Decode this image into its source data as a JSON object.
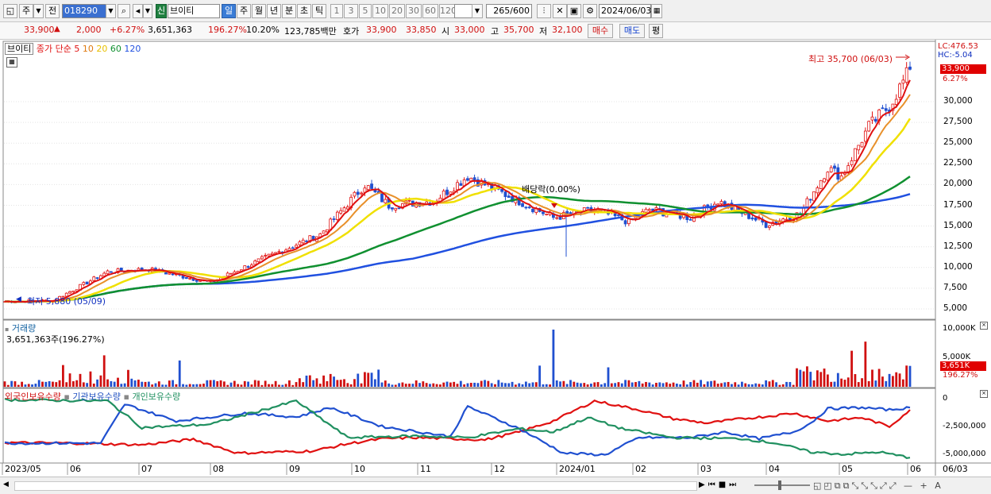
{
  "toolbar": {
    "market_btn": "주",
    "prev_btn": "전",
    "code": "018290",
    "badge": "신",
    "name": "브이티",
    "period_tabs": [
      "일",
      "주",
      "월",
      "년",
      "분",
      "초",
      "틱"
    ],
    "interval_tabs": [
      "1",
      "3",
      "5",
      "10",
      "20",
      "30",
      "60",
      "120"
    ],
    "count": "265",
    "count_total": "/600",
    "date": "2024/06/03"
  },
  "info": {
    "price": "33,900",
    "arrow": "▲",
    "change": "2,000",
    "rate": "+6.27%",
    "volume": "3,651,363",
    "vol_ratio": "196.27%",
    "turnover": "10.20%",
    "amount": "123,785백만",
    "ask_label": "호가",
    "ask": "33,900",
    "bid": "33,850",
    "open_label": "시",
    "open": "33,000",
    "high_label": "고",
    "high": "35,700",
    "low_label": "저",
    "low": "32,100",
    "buy_btn": "매수",
    "sell_btn": "매도",
    "eval_btn": "평"
  },
  "price_panel": {
    "name_tag": "브이티",
    "legend_label": "종가 단순",
    "ma_labels": [
      "5",
      "10",
      "20",
      "60",
      "120"
    ],
    "ma_colors": [
      "#e01010",
      "#e07a10",
      "#e8d000",
      "#109030",
      "#2050e0"
    ],
    "lc": "LC:476.53",
    "hc": "HC:-5.04",
    "cur_price": "33,900",
    "cur_rate": "6.27%",
    "high_note": "최고 35,700 (06/03)",
    "low_note": "최저 5,880 (05/09)",
    "div_note": "배당락(0.00%)",
    "y_ticks": [
      "30,000",
      "27,500",
      "25,000",
      "22,500",
      "20,000",
      "17,500",
      "15,000",
      "12,500",
      "10,000",
      "7,500",
      "5,000"
    ]
  },
  "volume_panel": {
    "title": "거래량",
    "readout": "3,651,363주(196.27%)",
    "y_ticks": [
      "10,000K",
      "5,000K"
    ],
    "cur_vol": "3,651K",
    "cur_rate": "196.27%"
  },
  "holding_panel": {
    "legend": [
      "외국인보유수량",
      "기관보유수량",
      "개인보유수량"
    ],
    "colors": [
      "#e01010",
      "#2050e0",
      "#209060"
    ],
    "y_ticks": [
      "0",
      "-2,500,000",
      "-5,000,000"
    ]
  },
  "x_axis": {
    "labels": [
      "2023/05",
      "06",
      "07",
      "08",
      "09",
      "10",
      "11",
      "12",
      "2024/01",
      "02",
      "03",
      "04",
      "05",
      "06"
    ],
    "right_label": "06/03"
  },
  "chart_data": {
    "type": "line",
    "title": "",
    "x_range": [
      "2023/05",
      "2024/06/03"
    ],
    "y_range": [
      4000,
      36000
    ],
    "close_approx": [
      5900,
      6000,
      9500,
      9800,
      8200,
      11000,
      14000,
      20000,
      17500,
      18000,
      21000,
      18000,
      16000,
      17000,
      15500,
      17000,
      16000,
      18000,
      15200,
      16500,
      22000,
      21000,
      27000,
      29500,
      33900
    ],
    "ma120_end": 19000,
    "ma60_end": 21300,
    "ma20_end": 26300,
    "ma10_end": 29000,
    "ma5_end": 31500
  }
}
